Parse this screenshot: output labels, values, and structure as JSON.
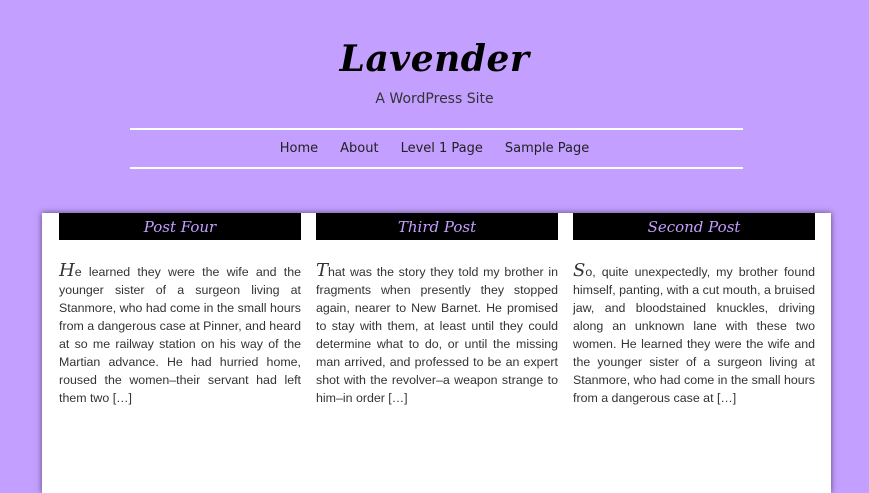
{
  "site": {
    "title": "Lavender",
    "tagline": "A WordPress Site"
  },
  "nav": {
    "items": [
      {
        "label": "Home"
      },
      {
        "label": "About"
      },
      {
        "label": "Level 1 Page"
      },
      {
        "label": "Sample Page"
      }
    ]
  },
  "posts": [
    {
      "title": "Post Four",
      "dropcap": "H",
      "excerpt": "e learned they were the wife and the younger sister of a surgeon living at Stanmore, who had come in the small hours from a dangerous case at Pinner, and heard at so me railway station on his way of the Martian advance. He had hurried home, roused the women–their servant had left them two […]"
    },
    {
      "title": "Third Post",
      "dropcap": "T",
      "excerpt": "hat was the story they told my brother in fragments when presently they stopped again, nearer to New Barnet. He promised to stay with them, at least until they could determine what to do, or until the missing man arrived, and professed to be an expert shot with the revolver–a weapon strange to him–in order […]"
    },
    {
      "title": "Second Post",
      "dropcap": "S",
      "excerpt": "o, quite unexpectedly, my brother found himself, panting, with a cut mouth, a bruised jaw, and bloodstained knuckles, driving along an unknown lane with these two women. He learned they were the wife and the younger sister of a surgeon living at Stanmore, who had come in the small hours from a dangerous case at […]"
    }
  ],
  "colors": {
    "background": "#c39fff",
    "title_bar": "#000000",
    "title_text": "#c39fff",
    "panel": "#ffffff",
    "nav_rule": "#ffffff"
  }
}
